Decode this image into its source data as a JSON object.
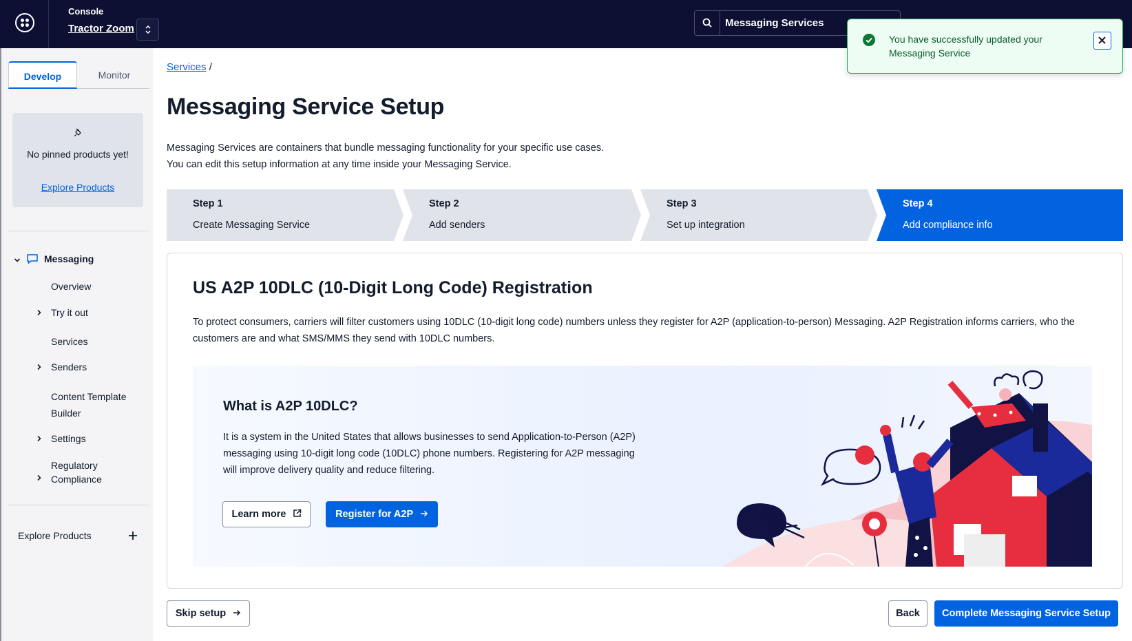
{
  "header": {
    "console_label": "Console",
    "account_name": "Tractor Zoom",
    "search_value": "Messaging Services",
    "icons": [
      "app-logo-icon",
      "switch-account-icon",
      "search-icon"
    ]
  },
  "toast": {
    "message": "You have successfully updated your Messaging Service",
    "status_color": "#14b053"
  },
  "sidebar": {
    "tabs": [
      {
        "label": "Develop"
      },
      {
        "label": "Monitor"
      }
    ],
    "pinned": {
      "empty_text": "No pinned products yet!",
      "link": "Explore Products"
    },
    "section": {
      "label": "Messaging"
    },
    "items": [
      {
        "label": "Overview"
      },
      {
        "label": "Try it out"
      },
      {
        "label": "Services"
      },
      {
        "label": "Senders"
      },
      {
        "label": "Content Template Builder"
      },
      {
        "label": "Settings"
      },
      {
        "label": "Regulatory Compliance"
      }
    ],
    "explore": {
      "label": "Explore Products"
    }
  },
  "main": {
    "breadcrumb": {
      "link": "Services",
      "separator": "/"
    },
    "title": "Messaging Service Setup",
    "description_line1": "Messaging Services are containers that bundle messaging functionality for your specific use cases.",
    "description_line2": "You can edit this setup information at any time inside your Messaging Service.",
    "steps": [
      {
        "number": "Step 1",
        "label": "Create Messaging Service"
      },
      {
        "number": "Step 2",
        "label": "Add senders"
      },
      {
        "number": "Step 3",
        "label": "Set up integration"
      },
      {
        "number": "Step 4",
        "label": "Add compliance info",
        "active": true
      }
    ],
    "card": {
      "title": "US A2P 10DLC (10-Digit Long Code) Registration",
      "description": "To protect consumers, carriers will filter customers using 10DLC (10-digit long code) numbers unless they register for A2P (application-to-person) Messaging. A2P Registration informs carriers, who the customers are and what SMS/MMS they send with 10DLC numbers.",
      "promo": {
        "title": "What is A2P 10DLC?",
        "description": "It is a system in the United States that allows businesses to send Application-to-Person (A2P) messaging using 10-digit long code (10DLC) phone numbers. Registering for A2P messaging will improve delivery quality and reduce filtering.",
        "learn_more": "Learn more",
        "register": "Register for A2P"
      }
    },
    "footer": {
      "skip": "Skip setup",
      "back": "Back",
      "complete": "Complete Messaging Service Setup"
    },
    "accent_color": "#0263e0"
  }
}
